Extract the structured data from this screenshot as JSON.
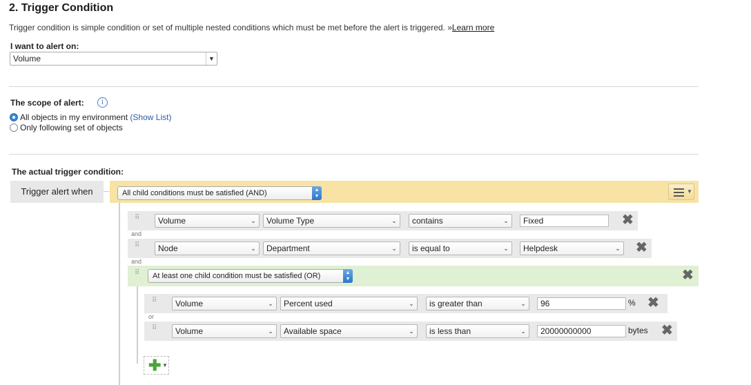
{
  "section": {
    "title": "2. Trigger Condition",
    "description": "Trigger condition is simple condition or set of multiple nested conditions which must be met before the alert is triggered.",
    "learn_more_prefix": "»",
    "learn_more": "Learn more"
  },
  "alert_on": {
    "label": "I want to alert on:",
    "value": "Volume"
  },
  "scope": {
    "label": "The scope of alert:",
    "options": [
      {
        "label": "All objects in my environment",
        "link": "(Show List)",
        "selected": true
      },
      {
        "label": "Only following set of objects",
        "selected": false
      }
    ]
  },
  "trigger": {
    "heading": "The actual trigger condition:",
    "when_label": "Trigger alert when",
    "root_group": "All child conditions must be satisfied (AND)",
    "conditions": [
      {
        "object": "Volume",
        "property": "Volume Type",
        "operator": "contains",
        "value": "Fixed",
        "connector": "and"
      },
      {
        "object": "Node",
        "property": "Department",
        "operator": "is equal to",
        "value": "Helpdesk",
        "connector": "and"
      }
    ],
    "nested_group": "At least one child condition must be satisfied (OR)",
    "nested_conditions": [
      {
        "object": "Volume",
        "property": "Percent used",
        "operator": "is greater than",
        "value": "96",
        "unit": "%",
        "connector": "or"
      },
      {
        "object": "Volume",
        "property": "Available space",
        "operator": "is less than",
        "value": "20000000000",
        "unit": "bytes"
      }
    ]
  },
  "colors": {
    "and_band": "#f8e3a4",
    "or_band": "#dff0d3",
    "link": "#2f5aa8",
    "add_icon": "#4aa43b"
  }
}
